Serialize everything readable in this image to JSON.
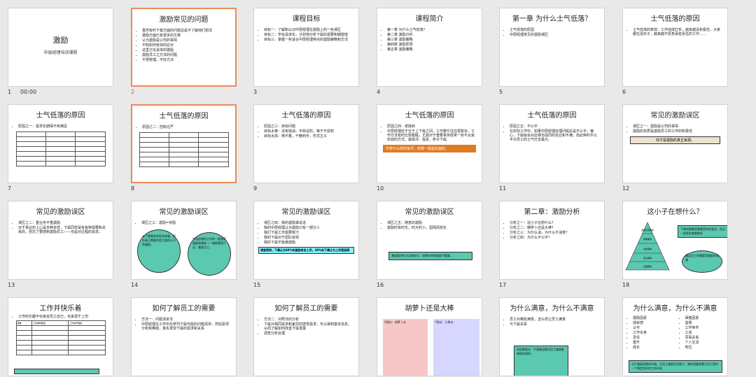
{
  "slides": [
    {
      "num": "1",
      "duration": "00:00",
      "title": "激励",
      "subtitle": "中层经理培训课程"
    },
    {
      "num": "2",
      "title": "激励常见的问题",
      "bullets": [
        "虽然有时下载方面的问题总是不了解他们想法",
        "激励方面已有很多的文章",
        "认为激励是公司的事情",
        "不知如何有效的应对",
        "这里讨论具体的激励",
        "激励员工之方法的问题",
        "不便管理，不好方法"
      ]
    },
    {
      "num": "3",
      "title": "课程目标",
      "bullets": [
        "目标一：了解和认识中层经理在激励上的一些误区",
        "目标二：学会具体化，分别地分析下属的需要和期望值",
        "目标三：掌握一些适合中层经理特点的激励策略和方法"
      ]
    },
    {
      "num": "4",
      "title": "课程简介",
      "bullets": [
        "第一章 为什么士气低落？",
        "第二章 激励分析",
        "第三章 激励策略",
        "第四章 激励原则",
        "第五章 激励策略"
      ]
    },
    {
      "num": "5",
      "title": "第一章 为什么士气低落？",
      "bullets": [
        "士气低落的原因",
        "中层经理常见的激励误区"
      ]
    },
    {
      "num": "6",
      "title": "士气低落的原因",
      "bullets": [
        "士气低落的表现：工作完成打折，越来越没积极性，大家都在混日子，越来越不愿意承担责任的工作……"
      ]
    },
    {
      "num": "7",
      "title": "士气低落的原因",
      "bullets": [
        "原因之一：需求长期得不到满足"
      ]
    },
    {
      "num": "8",
      "title": "士气低落的原因",
      "bullets": [
        "原因之二：控制过严"
      ]
    },
    {
      "num": "9",
      "title": "士气低落的原因",
      "bullets": [
        "原因之三：目标问题",
        "目标太难：没有挑战，半箭设防，等于不授权",
        "目标太高：够不着，干脆到手，形式主义"
      ]
    },
    {
      "num": "10",
      "title": "士气低落的原因",
      "bullets": [
        "原因之四：老挑刺",
        "中层经理处于位于上下级之间，工作繁忙往往很复杂，工作方法有时比较粗糙，尤其对于重要事务经常一些不太受欢迎的方式，最批评、指责、命令下属"
      ],
      "highlight": "不管什么样的批评，效果一般是反面的。"
    },
    {
      "num": "11",
      "title": "士气低落的原因",
      "bullets": [
        "原因之五：不公平",
        "在实际工作中，如果中层经理处理问题总是不公平，偏心，下属就会对此相当强烈的反应和不满，而此种的不公平对员工的士气打击最大。"
      ]
    },
    {
      "num": "12",
      "title": "常见的激励误区",
      "bullets": [
        "误区之一：激励是公司的事情",
        "激励的实质是激励员工的工作的积极性"
      ],
      "highlight": "你才是激励的真正来源。"
    },
    {
      "num": "13",
      "title": "常见的激励误区",
      "bullets": [
        "误区之二：重业务不重激励",
        "对于事业的上心是多种多样，下属同样是有各种需要和关系的，别忘了要感到激励员工——也是对过程的追求。"
      ]
    },
    {
      "num": "14",
      "title": "常见的激励误区",
      "bullets": [
        "误区之三：激励=奖励"
      ],
      "circle_left": "从下属需求的现状来看，现在真正需要的是主管的认可和激励。",
      "circle_right": "中层经理的工作的一类就是激励和激励——激励管理人员，激励员工。"
    },
    {
      "num": "15",
      "title": "常见的激励误区",
      "bullets": [
        "误区之四：我的激励谁说话",
        "我的中层经理认为激励只有一部分人",
        "我们下属工作需要努力",
        "我的下属对于团队有效",
        "我的下属不能被激励"
      ],
      "highlight": "调查表明，下属认为60%的激励来自上司，30%的下属认为上司是阻碍"
    },
    {
      "num": "16",
      "title": "常见的激励误区",
      "bullets": [
        "误区之五：随意的激励",
        "激励时有时无，时大时小，因情而变化"
      ],
      "highlight": "激励要讲究方法和技巧，如果你觉得激励不重要..."
    },
    {
      "num": "17",
      "title": "第二章：激励分析",
      "bullets": [
        "分析之一：这小子在想什么？",
        "分析之二：精罗卜还是大棒？",
        "分析之三：为什么消，为什么不消意？",
        "分析之四：为什么不公平？"
      ]
    },
    {
      "num": "18",
      "title": "这小子在想什么？",
      "pyramid": [
        "自我实现需求",
        "尊重需求",
        "社会需求",
        "安全需求",
        "生理需求"
      ],
      "note1": "下属的需要是需要是有些变化，而且一般是在尊重需求",
      "note2": "满足员工的需要是激励的关键"
    },
    {
      "num": "19",
      "title": "工作并快乐着",
      "bullets": [
        "工作的乐趣不仅来自员工自己，也来源于上司"
      ],
      "table_head": [
        "需要",
        "工作重视程度",
        "工作快乐程度"
      ]
    },
    {
      "num": "20",
      "title": "如何了解员工的需要",
      "bullets": [
        "方法一：问题清单法",
        "中层经理在工作中先罗列下属可能的问题清单，然后逐项分析和推敲，真实发现下属的需求和关系"
      ]
    },
    {
      "num": "21",
      "title": "如何了解员工的需要",
      "bullets": [
        "方法二：对照法的分析",
        "下属对相同需求和差异的感觉需求，可以得到基本信息，从而了解如何改善下属发展",
        "调查分析处理"
      ]
    },
    {
      "num": "22",
      "title": "胡萝卜还是大棒",
      "col_left_head": "X理论：胡萝卜派",
      "col_right_head": "Y理论：大棒派"
    },
    {
      "num": "23",
      "title": "为什么满意，为什么不满意",
      "bullets": [
        "员工对哪些满意，怎么样让员工满意",
        "与下属关系",
        "良好的沟通和交流"
      ],
      "note": "双因素理论：不满意因素对员工激励影响是有限的..."
    },
    {
      "num": "24",
      "title": "为什么满意，为什么不满意",
      "bullets": [
        "激励因素",
        "成就感",
        "认可",
        "工作本身",
        "责任",
        "晋升",
        "成长",
        "保健因素",
        "监督",
        "工作条件",
        "工资",
        "同事关系",
        "个人生活",
        "地位"
      ],
      "note": "对于激励因素的实施，对员工激励作用更大，做好保健因素为员工提供一个稳定良好的工作环境"
    }
  ]
}
